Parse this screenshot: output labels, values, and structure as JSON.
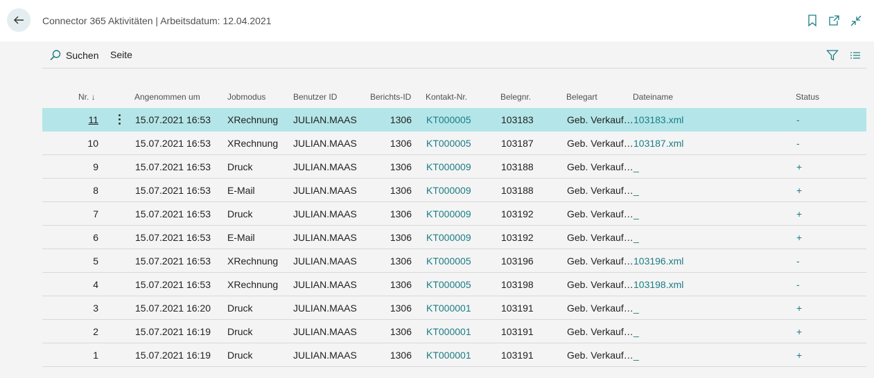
{
  "header": {
    "title": "Connector 365 Aktivitäten | Arbeitsdatum: 12.04.2021"
  },
  "toolbar": {
    "search_label": "Suchen",
    "page_label": "Seite"
  },
  "colors": {
    "accent": "#1a7c83",
    "selected_row": "#b4e6e9"
  },
  "icons": [
    "back-arrow-icon",
    "bookmark-icon",
    "open-in-new-window-icon",
    "collapse-icon",
    "search-icon",
    "filter-icon",
    "list-view-icon",
    "sort-descending-icon",
    "row-menu-icon"
  ],
  "table": {
    "columns": [
      "Nr.",
      "Angenommen um",
      "Jobmodus",
      "Benutzer ID",
      "Berichts-ID",
      "Kontakt-Nr.",
      "Belegnr.",
      "Belegart",
      "Dateiname",
      "Status"
    ],
    "rows": [
      {
        "nr": "11",
        "date": "15.07.2021 16:53",
        "mode": "XRechnung",
        "user": "JULIAN.MAAS",
        "report": "1306",
        "contact": "KT000005",
        "doc": "103183",
        "type": "Geb. Verkauf…",
        "file": "103183.xml",
        "status": "-"
      },
      {
        "nr": "10",
        "date": "15.07.2021 16:53",
        "mode": "XRechnung",
        "user": "JULIAN.MAAS",
        "report": "1306",
        "contact": "KT000005",
        "doc": "103187",
        "type": "Geb. Verkauf…",
        "file": "103187.xml",
        "status": "-"
      },
      {
        "nr": "9",
        "date": "15.07.2021 16:53",
        "mode": "Druck",
        "user": "JULIAN.MAAS",
        "report": "1306",
        "contact": "KT000009",
        "doc": "103188",
        "type": "Geb. Verkauf…",
        "file": "_",
        "status": "+"
      },
      {
        "nr": "8",
        "date": "15.07.2021 16:53",
        "mode": "E-Mail",
        "user": "JULIAN.MAAS",
        "report": "1306",
        "contact": "KT000009",
        "doc": "103188",
        "type": "Geb. Verkauf…",
        "file": "_",
        "status": "+"
      },
      {
        "nr": "7",
        "date": "15.07.2021 16:53",
        "mode": "Druck",
        "user": "JULIAN.MAAS",
        "report": "1306",
        "contact": "KT000009",
        "doc": "103192",
        "type": "Geb. Verkauf…",
        "file": "_",
        "status": "+"
      },
      {
        "nr": "6",
        "date": "15.07.2021 16:53",
        "mode": "E-Mail",
        "user": "JULIAN.MAAS",
        "report": "1306",
        "contact": "KT000009",
        "doc": "103192",
        "type": "Geb. Verkauf…",
        "file": "_",
        "status": "+"
      },
      {
        "nr": "5",
        "date": "15.07.2021 16:53",
        "mode": "XRechnung",
        "user": "JULIAN.MAAS",
        "report": "1306",
        "contact": "KT000005",
        "doc": "103196",
        "type": "Geb. Verkauf…",
        "file": "103196.xml",
        "status": "-"
      },
      {
        "nr": "4",
        "date": "15.07.2021 16:53",
        "mode": "XRechnung",
        "user": "JULIAN.MAAS",
        "report": "1306",
        "contact": "KT000005",
        "doc": "103198",
        "type": "Geb. Verkauf…",
        "file": "103198.xml",
        "status": "-"
      },
      {
        "nr": "3",
        "date": "15.07.2021 16:20",
        "mode": "Druck",
        "user": "JULIAN.MAAS",
        "report": "1306",
        "contact": "KT000001",
        "doc": "103191",
        "type": "Geb. Verkauf…",
        "file": "_",
        "status": "+"
      },
      {
        "nr": "2",
        "date": "15.07.2021 16:19",
        "mode": "Druck",
        "user": "JULIAN.MAAS",
        "report": "1306",
        "contact": "KT000001",
        "doc": "103191",
        "type": "Geb. Verkauf…",
        "file": "_",
        "status": "+"
      },
      {
        "nr": "1",
        "date": "15.07.2021 16:19",
        "mode": "Druck",
        "user": "JULIAN.MAAS",
        "report": "1306",
        "contact": "KT000001",
        "doc": "103191",
        "type": "Geb. Verkauf…",
        "file": "_",
        "status": "+"
      }
    ]
  }
}
